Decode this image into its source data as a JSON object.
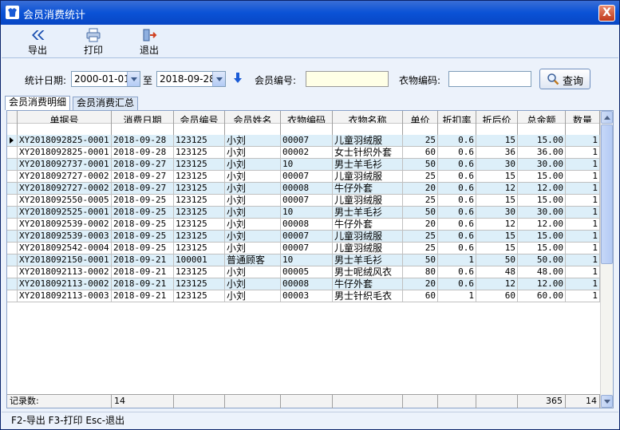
{
  "window": {
    "title": "会员消费统计",
    "close_glyph": "X"
  },
  "toolbar": {
    "export_label": "导出",
    "print_label": "打印",
    "exit_label": "退出"
  },
  "filter": {
    "date_label": "统计日期:",
    "date_from": "2000-01-01",
    "date_sep": "至",
    "date_to": "2018-09-28",
    "member_label": "会员编号:",
    "member_value": "",
    "clothing_label": "衣物编码:",
    "clothing_value": "",
    "query_label": "查询"
  },
  "tabs": [
    {
      "label": "会员消费明细",
      "active": true
    },
    {
      "label": "会员消费汇总",
      "active": false
    }
  ],
  "grid": {
    "columns": [
      "单据号",
      "消费日期",
      "会员编号",
      "会员姓名",
      "衣物编码",
      "衣物名称",
      "单价",
      "折扣率",
      "折后价",
      "总金额",
      "数量"
    ],
    "rows": [
      [
        "XY2018092825-0001",
        "2018-09-28",
        "123125",
        "小刘",
        "00007",
        "儿童羽绒服",
        "25",
        "0.6",
        "15",
        "15.00",
        "1"
      ],
      [
        "XY2018092825-0001",
        "2018-09-28",
        "123125",
        "小刘",
        "00002",
        "女士针织外套",
        "60",
        "0.6",
        "36",
        "36.00",
        "1"
      ],
      [
        "XY2018092737-0001",
        "2018-09-27",
        "123125",
        "小刘",
        "10",
        "男士羊毛衫",
        "50",
        "0.6",
        "30",
        "30.00",
        "1"
      ],
      [
        "XY2018092727-0002",
        "2018-09-27",
        "123125",
        "小刘",
        "00007",
        "儿童羽绒服",
        "25",
        "0.6",
        "15",
        "15.00",
        "1"
      ],
      [
        "XY2018092727-0002",
        "2018-09-27",
        "123125",
        "小刘",
        "00008",
        "牛仔外套",
        "20",
        "0.6",
        "12",
        "12.00",
        "1"
      ],
      [
        "XY2018092550-0005",
        "2018-09-25",
        "123125",
        "小刘",
        "00007",
        "儿童羽绒服",
        "25",
        "0.6",
        "15",
        "15.00",
        "1"
      ],
      [
        "XY2018092525-0001",
        "2018-09-25",
        "123125",
        "小刘",
        "10",
        "男士羊毛衫",
        "50",
        "0.6",
        "30",
        "30.00",
        "1"
      ],
      [
        "XY2018092539-0002",
        "2018-09-25",
        "123125",
        "小刘",
        "00008",
        "牛仔外套",
        "20",
        "0.6",
        "12",
        "12.00",
        "1"
      ],
      [
        "XY2018092539-0003",
        "2018-09-25",
        "123125",
        "小刘",
        "00007",
        "儿童羽绒服",
        "25",
        "0.6",
        "15",
        "15.00",
        "1"
      ],
      [
        "XY2018092542-0004",
        "2018-09-25",
        "123125",
        "小刘",
        "00007",
        "儿童羽绒服",
        "25",
        "0.6",
        "15",
        "15.00",
        "1"
      ],
      [
        "XY2018092150-0001",
        "2018-09-21",
        "100001",
        "普通顾客",
        "10",
        "男士羊毛衫",
        "50",
        "1",
        "50",
        "50.00",
        "1"
      ],
      [
        "XY2018092113-0002",
        "2018-09-21",
        "123125",
        "小刘",
        "00005",
        "男士呢绒风衣",
        "80",
        "0.6",
        "48",
        "48.00",
        "1"
      ],
      [
        "XY2018092113-0002",
        "2018-09-21",
        "123125",
        "小刘",
        "00008",
        "牛仔外套",
        "20",
        "0.6",
        "12",
        "12.00",
        "1"
      ],
      [
        "XY2018092113-0003",
        "2018-09-21",
        "123125",
        "小刘",
        "00003",
        "男士针织毛衣",
        "60",
        "1",
        "60",
        "60.00",
        "1"
      ]
    ],
    "footer": {
      "count_label": "记录数:",
      "count_value": "14",
      "total_amount": "365",
      "total_qty": "14"
    }
  },
  "statusbar": {
    "text": "F2-导出 F3-打印 Esc-退出"
  },
  "colors": {
    "titlebar": "#0a52d6",
    "alt_row": "#ddeff9",
    "accent": "#1a5bd6"
  }
}
